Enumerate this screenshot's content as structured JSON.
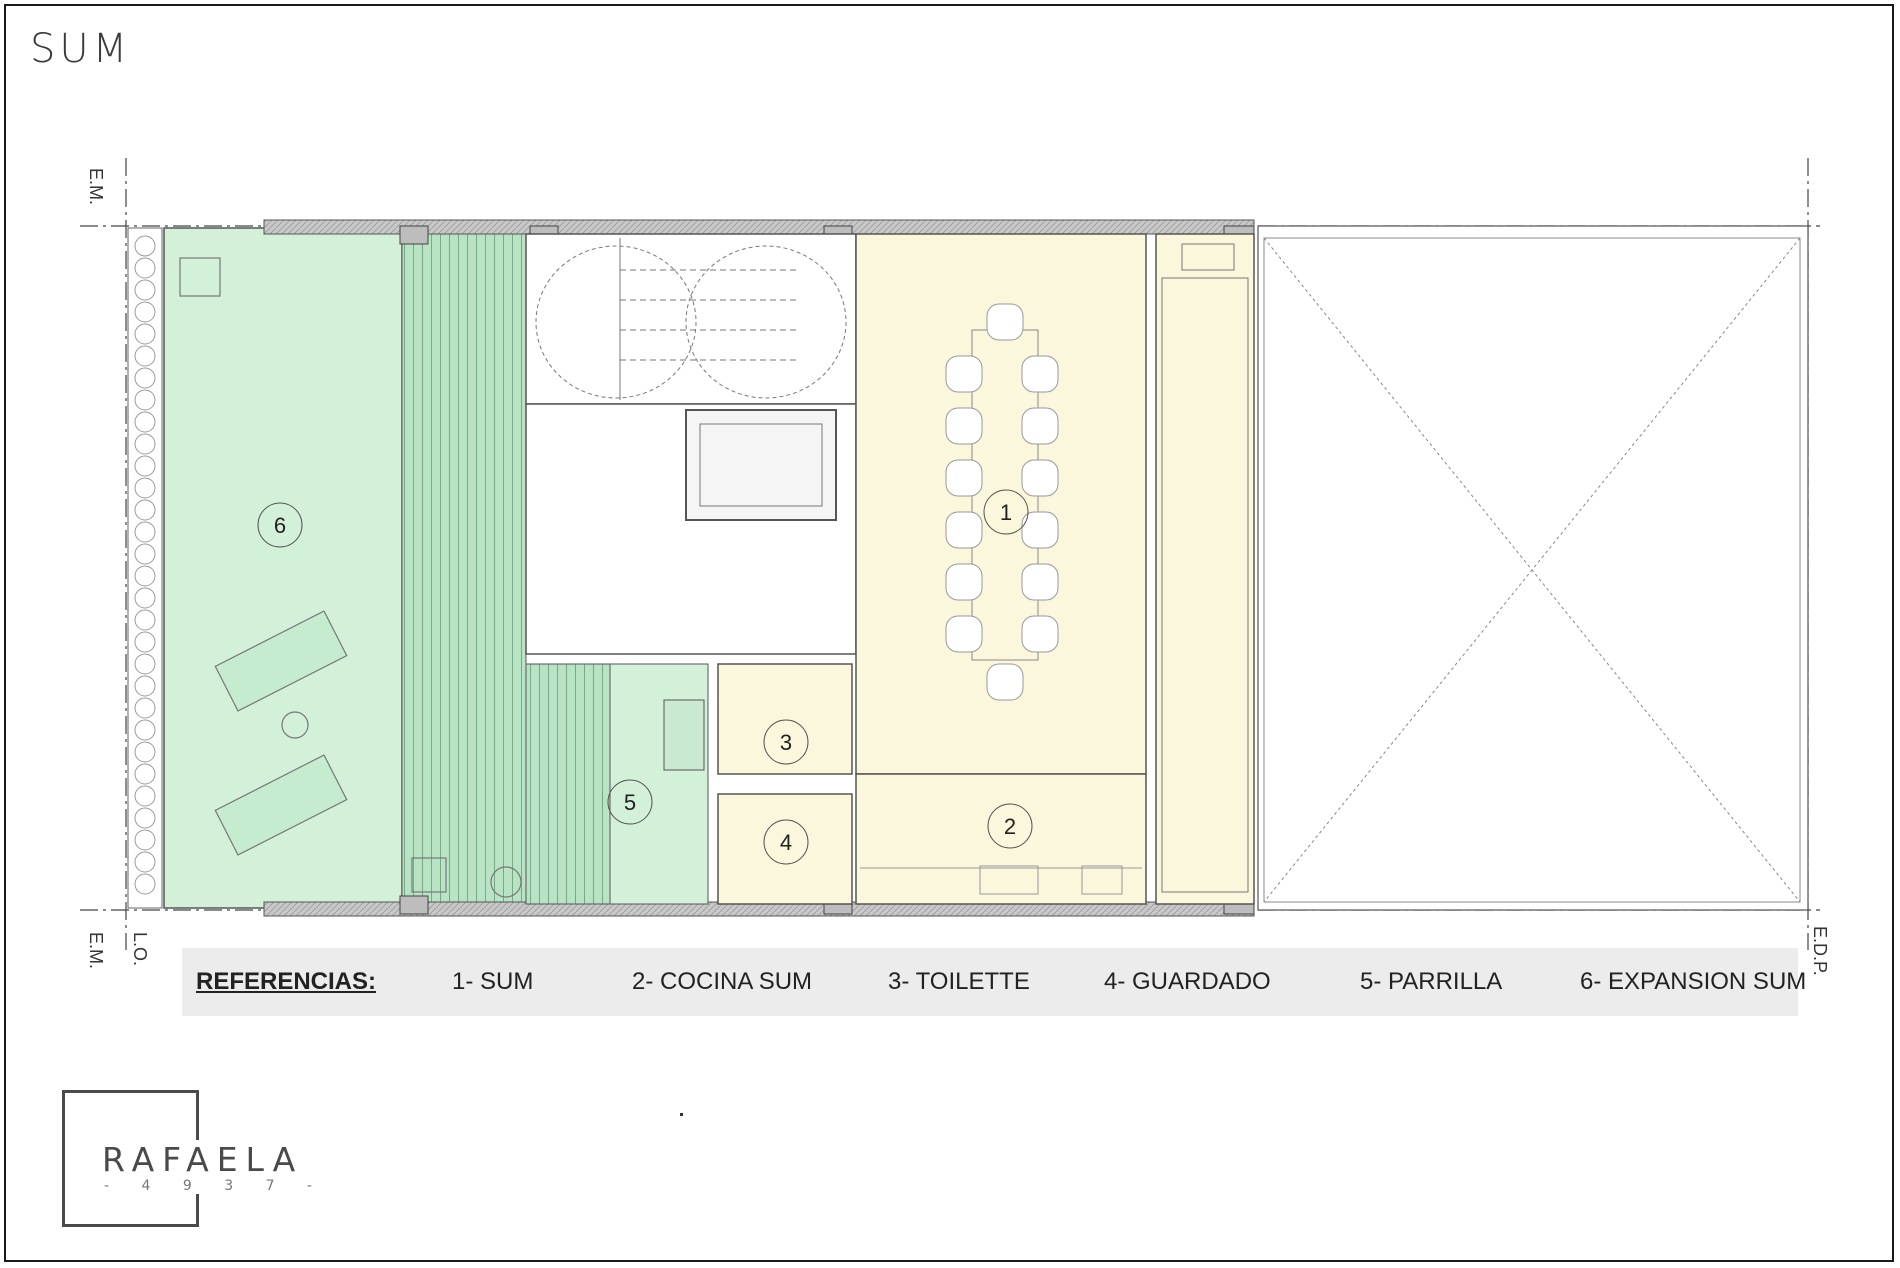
{
  "title": "SUM",
  "axes": {
    "em_top": "E.M.",
    "em_bottom": "E.M.",
    "lo": "L.O.",
    "edp": "E.D.P."
  },
  "room_numbers": [
    "1",
    "2",
    "3",
    "4",
    "5",
    "6"
  ],
  "legend": {
    "header": "REFERENCIAS:",
    "items": [
      "1- SUM",
      "2- COCINA SUM",
      "3- TOILETTE",
      "4- GUARDADO",
      "5- PARRILLA",
      "6- EXPANSION SUM"
    ]
  },
  "logo": {
    "name": "RAFAELA",
    "number": "- 4 9 3 7 -"
  },
  "colors": {
    "expansion_green": "#d3f0d9",
    "deck_green": "#b9e3c4",
    "sum_yellow": "#fbf7dc",
    "wall_gray": "#bdbdbd",
    "line": "#333333",
    "legend_bg": "#ececec"
  }
}
